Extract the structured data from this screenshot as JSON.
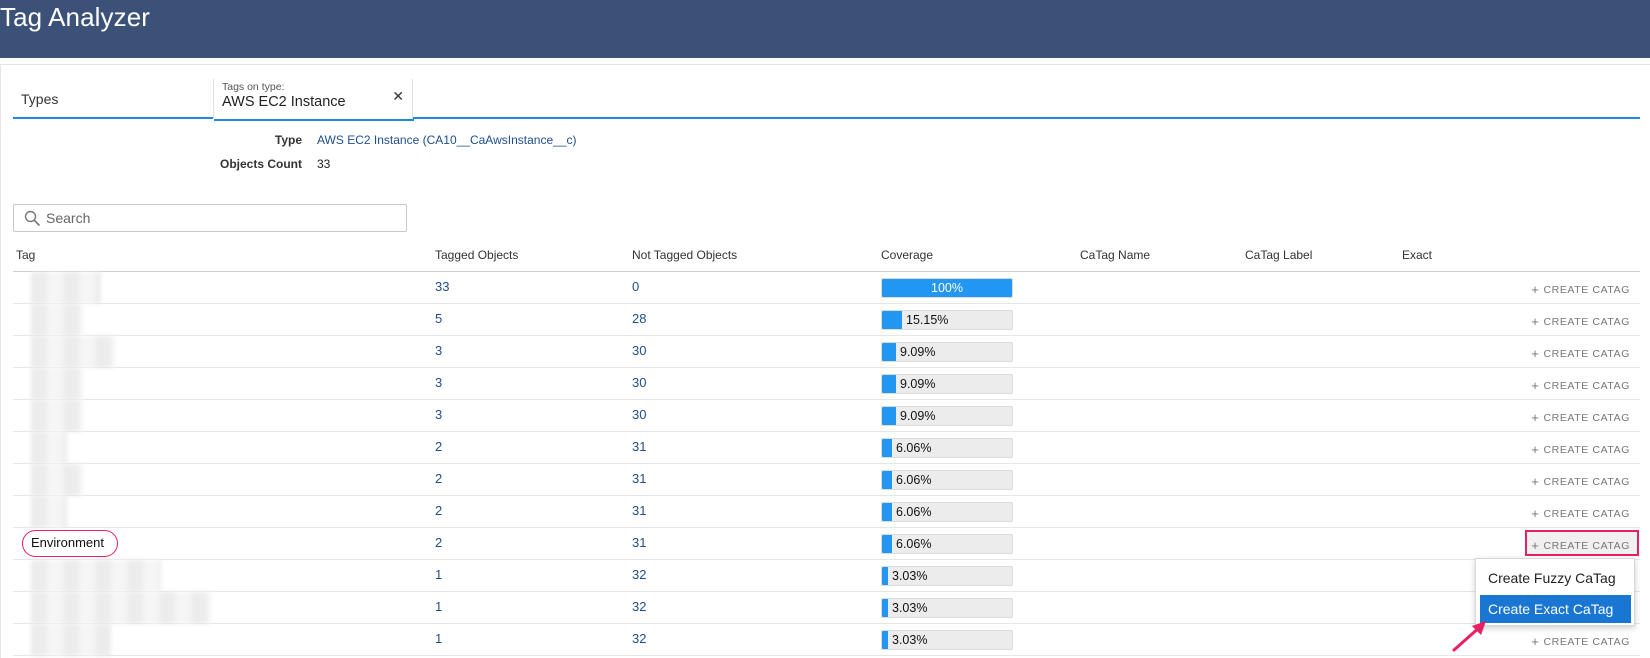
{
  "app": {
    "title": "Tag Analyzer"
  },
  "tabs": {
    "types_label": "Types",
    "active_caption": "Tags on type:",
    "active_value": "AWS EC2 Instance",
    "close_glyph": "✕"
  },
  "details": {
    "type_label": "Type",
    "type_value": "AWS EC2 Instance (CA10__CaAwsInstance__c)",
    "count_label": "Objects Count",
    "count_value": "33"
  },
  "search": {
    "placeholder": "Search",
    "value": ""
  },
  "table": {
    "headers": {
      "tag": "Tag",
      "tagged": "Tagged Objects",
      "not_tagged": "Not Tagged Objects",
      "coverage": "Coverage",
      "catag_name": "CaTag Name",
      "catag_label": "CaTag Label",
      "exact": "Exact"
    },
    "action_label": "CREATE CATAG",
    "action_glyph": "+",
    "rows": [
      {
        "tag": "",
        "tagged": "33",
        "not_tagged": "0",
        "coverage": "100%",
        "coverage_value": 1.0
      },
      {
        "tag": "",
        "tagged": "5",
        "not_tagged": "28",
        "coverage": "15.15%",
        "coverage_value": 0.1515
      },
      {
        "tag": "",
        "tagged": "3",
        "not_tagged": "30",
        "coverage": "9.09%",
        "coverage_value": 0.0909
      },
      {
        "tag": "",
        "tagged": "3",
        "not_tagged": "30",
        "coverage": "9.09%",
        "coverage_value": 0.0909
      },
      {
        "tag": "",
        "tagged": "3",
        "not_tagged": "30",
        "coverage": "9.09%",
        "coverage_value": 0.0909
      },
      {
        "tag": "",
        "tagged": "2",
        "not_tagged": "31",
        "coverage": "6.06%",
        "coverage_value": 0.0606
      },
      {
        "tag": "",
        "tagged": "2",
        "not_tagged": "31",
        "coverage": "6.06%",
        "coverage_value": 0.0606
      },
      {
        "tag": "",
        "tagged": "2",
        "not_tagged": "31",
        "coverage": "6.06%",
        "coverage_value": 0.0606
      },
      {
        "tag": "Environment",
        "tagged": "2",
        "not_tagged": "31",
        "coverage": "6.06%",
        "coverage_value": 0.0606
      },
      {
        "tag": "",
        "tagged": "1",
        "not_tagged": "32",
        "coverage": "3.03%",
        "coverage_value": 0.0303
      },
      {
        "tag": "",
        "tagged": "1",
        "not_tagged": "32",
        "coverage": "3.03%",
        "coverage_value": 0.0303
      },
      {
        "tag": "",
        "tagged": "1",
        "not_tagged": "32",
        "coverage": "3.03%",
        "coverage_value": 0.0303
      }
    ]
  },
  "menu": {
    "fuzzy_label": "Create Fuzzy CaTag",
    "exact_label": "Create Exact CaTag"
  },
  "colors": {
    "header_bg": "#3b5178",
    "accent": "#1e88e5",
    "bar_fill": "#2196f3",
    "highlight": "#e91e63",
    "link": "#1e4e8c"
  }
}
